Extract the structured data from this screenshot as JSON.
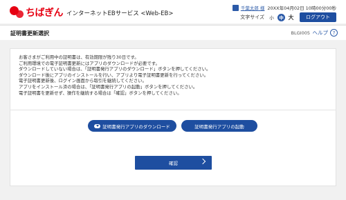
{
  "header": {
    "logo_text": "ちばぎん",
    "service_name": "インターネットEBサービス <Web-EB>",
    "user_name": "千葉太郎 様",
    "login_datetime": "20XX年04月02日 10時00分00秒",
    "font_size_label": "文字サイズ",
    "font_sizes": [
      "小",
      "中",
      "大"
    ],
    "logout_label": "ログアウト"
  },
  "titlebar": {
    "title": "証明書更新選択",
    "screen_id": "BLGI005",
    "help_label": "ヘルプ",
    "help_icon_glyph": "?"
  },
  "message": {
    "lines": [
      "お客さまがご利用中の証明書は、有効期限が残り30日です。",
      "ご利用環境での電子証明書更新にはアプリのダウンロードが必要です。",
      "ダウンロードしていない場合は、「証明書発行アプリのダウンロード」ボタンを押してください。",
      "ダウンロード後にアプリのインストールを行い、アプリより電子証明書更新を行ってください。",
      "電子証明書更新後、ログイン画面から取引を継続してください。",
      "アプリをインストール済の場合は、「証明書発行アプリの起動」ボタンを押してください。",
      "電子証明書を更新せず、操作を継続する場合は「確認」ボタンを押してください。"
    ]
  },
  "actions": {
    "download_label": "証明書発行アプリのダウンロード",
    "launch_label": "証明書発行アプリの起動",
    "confirm_label": "確認"
  },
  "colors": {
    "brand_red": "#e60012",
    "primary_blue": "#1e4ea0"
  }
}
